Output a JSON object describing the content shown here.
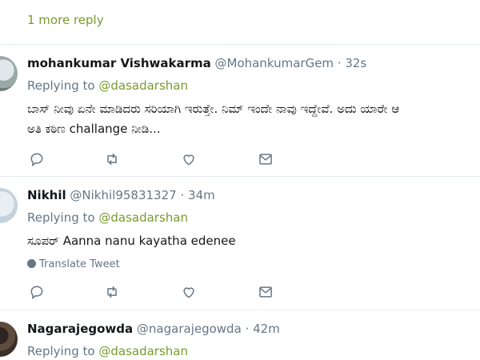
{
  "thread": {
    "more_reply_label": "1 more reply"
  },
  "tweets": [
    {
      "name": "mohankumar Vishwakarma",
      "handle": "@MohankumarGem",
      "separator": "·",
      "time": "32s",
      "replying_prefix": "Replying to",
      "replying_to": "@dasadarshan",
      "text_lines": [
        "ಬಾಸ್ ನೀವು ಏನೇ ಮಾಡಿದರು ಸರಿಯಾಗಿ ಇರುತ್ತೇ. ನಿಮ್ ಇಂದೇ ನಾವು ಇದ್ದೇವೆ. ಅದು ಯಾರೇ ಆ",
        "ಅತಿ ಕಠಿಣ challange ನೀಡಿ..."
      ]
    },
    {
      "name": "Nikhil",
      "handle": "@Nikhil95831327",
      "separator": "·",
      "time": "34m",
      "replying_prefix": "Replying to",
      "replying_to": "@dasadarshan",
      "text_lines": [
        "ಸೂಪರ್ Aanna nanu kayatha edenee"
      ],
      "translate_label": "Translate Tweet"
    },
    {
      "name": "Nagarajegowda",
      "handle": "@nagarajegowda",
      "separator": "·",
      "time": "42m",
      "replying_prefix": "Replying to",
      "replying_to": "@dasadarshan"
    }
  ],
  "icons": [
    "reply-icon",
    "retweet-icon",
    "like-icon",
    "direct-message-icon",
    "globe-icon"
  ],
  "colors": {
    "link": "#7a9a2e",
    "secondary_text": "#657786",
    "divider": "#e6ecf0"
  }
}
